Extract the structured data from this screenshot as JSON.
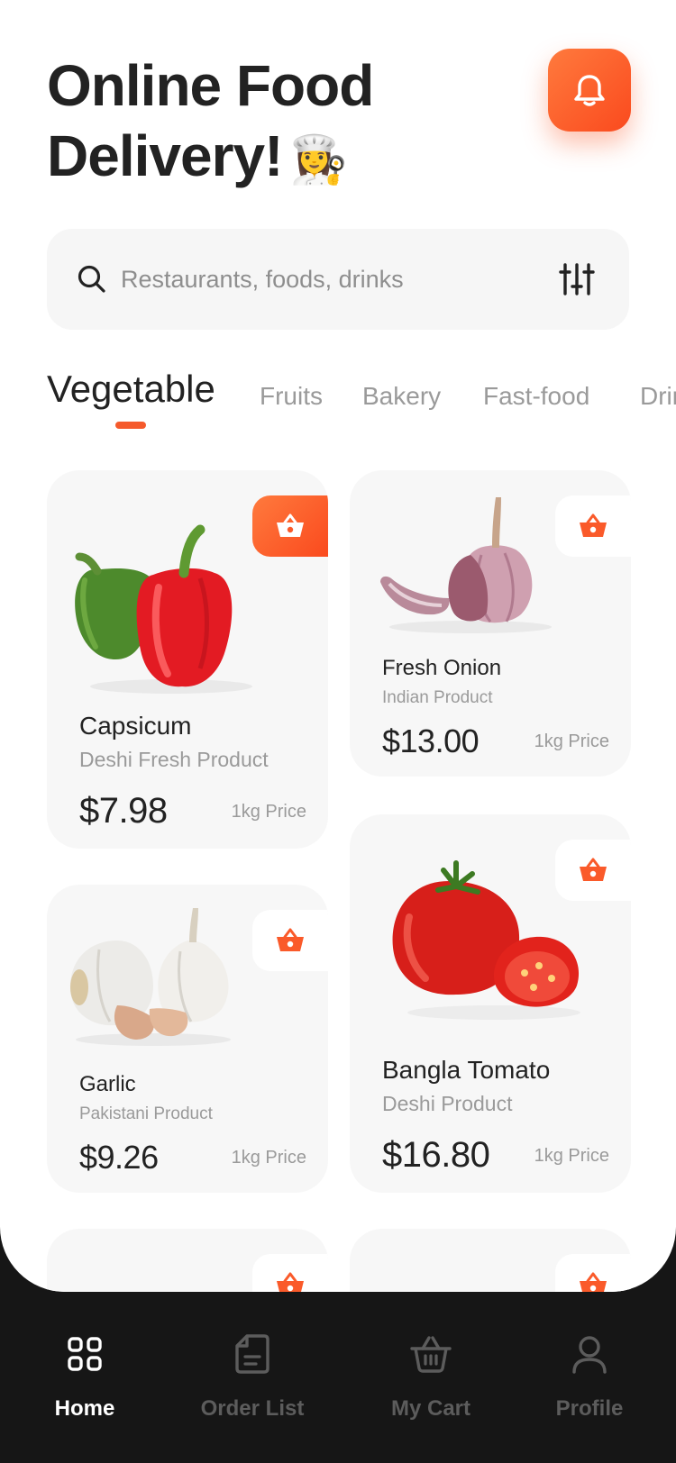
{
  "header": {
    "title_line1": "Online Food",
    "title_line2": "Delivery!",
    "title_emoji": "👩‍🍳",
    "bell_icon": "bell-icon"
  },
  "search": {
    "placeholder": "Restaurants, foods, drinks",
    "value": "",
    "search_icon": "search-icon",
    "filter_icon": "filter-sliders-icon"
  },
  "categories": [
    {
      "label": "Vegetable",
      "active": true
    },
    {
      "label": "Fruits",
      "active": false
    },
    {
      "label": "Bakery",
      "active": false
    },
    {
      "label": "Fast-food",
      "active": false
    },
    {
      "label": "Drinks",
      "active": false
    }
  ],
  "products": [
    {
      "name": "Capsicum",
      "origin": "Deshi Fresh Product",
      "price": "$7.98",
      "unit": "1kg Price",
      "cart_active": true
    },
    {
      "name": "Fresh Onion",
      "origin": "Indian Product",
      "price": "$13.00",
      "unit": "1kg Price",
      "cart_active": false
    },
    {
      "name": "Garlic",
      "origin": "Pakistani Product",
      "price": "$9.26",
      "unit": "1kg Price",
      "cart_active": false
    },
    {
      "name": "Bangla Tomato",
      "origin": "Deshi Product",
      "price": "$16.80",
      "unit": "1kg Price",
      "cart_active": false
    }
  ],
  "nav": {
    "items": [
      {
        "label": "Home",
        "icon": "grid-icon",
        "active": true
      },
      {
        "label": "Order List",
        "icon": "document-icon",
        "active": false
      },
      {
        "label": "My Cart",
        "icon": "basket-icon",
        "active": false
      },
      {
        "label": "Profile",
        "icon": "user-icon",
        "active": false
      }
    ]
  },
  "colors": {
    "accent": "#fa5a2a",
    "nav_background": "#161616",
    "card_background": "#f7f7f7"
  }
}
